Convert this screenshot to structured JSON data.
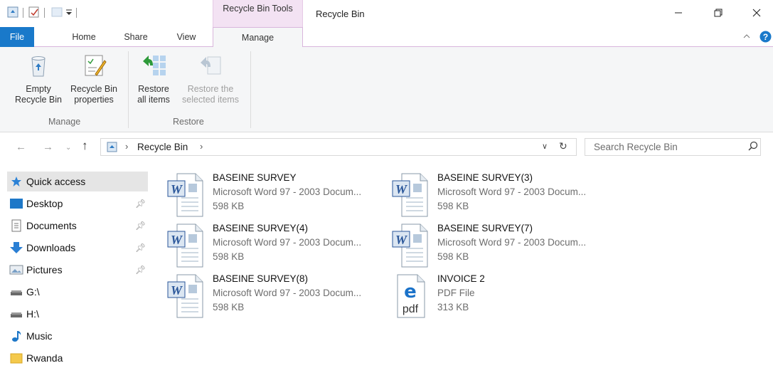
{
  "titlebar": {
    "contextual_tab": "Recycle Bin Tools",
    "window_title": "Recycle Bin",
    "controls": [
      "minimize-icon",
      "restore-icon",
      "close-icon"
    ]
  },
  "ribbon_tabs": [
    {
      "label": "File"
    },
    {
      "label": "Home"
    },
    {
      "label": "Share"
    },
    {
      "label": "View"
    },
    {
      "label": "Manage"
    }
  ],
  "ribbon": {
    "manage_group": {
      "label": "Manage",
      "empty_line1": "Empty",
      "empty_line2": "Recycle Bin",
      "props_line1": "Recycle Bin",
      "props_line2": "properties"
    },
    "restore_group": {
      "label": "Restore",
      "restore_all_line1": "Restore",
      "restore_all_line2": "all items",
      "restore_sel_line1": "Restore the",
      "restore_sel_line2": "selected items"
    }
  },
  "address": {
    "path": "Recycle Bin",
    "search_placeholder": "Search Recycle Bin"
  },
  "nav": {
    "items": [
      {
        "label": "Quick access",
        "icon": "star-icon"
      },
      {
        "label": "Desktop",
        "icon": "desktop-icon",
        "pinned": true
      },
      {
        "label": "Documents",
        "icon": "documents-icon",
        "pinned": true
      },
      {
        "label": "Downloads",
        "icon": "downloads-icon",
        "pinned": true
      },
      {
        "label": "Pictures",
        "icon": "pictures-icon",
        "pinned": true
      },
      {
        "label": "G:\\",
        "icon": "drive-icon"
      },
      {
        "label": "H:\\",
        "icon": "drive-icon"
      },
      {
        "label": "Music",
        "icon": "music-icon"
      },
      {
        "label": "Rwanda",
        "icon": "folder-icon"
      }
    ]
  },
  "files": [
    {
      "name": "BASEINE SURVEY",
      "type": "Microsoft Word 97 - 2003 Docum...",
      "size": "598 KB",
      "icon": "word-doc-icon"
    },
    {
      "name": "BASEINE SURVEY(3)",
      "type": "Microsoft Word 97 - 2003 Docum...",
      "size": "598 KB",
      "icon": "word-doc-icon"
    },
    {
      "name": "BASEINE SURVEY(4)",
      "type": "Microsoft Word 97 - 2003 Docum...",
      "size": "598 KB",
      "icon": "word-doc-icon"
    },
    {
      "name": "BASEINE SURVEY(7)",
      "type": "Microsoft Word 97 - 2003 Docum...",
      "size": "598 KB",
      "icon": "word-doc-icon"
    },
    {
      "name": "BASEINE SURVEY(8)",
      "type": "Microsoft Word 97 - 2003 Docum...",
      "size": "598 KB",
      "icon": "word-doc-icon"
    },
    {
      "name": "INVOICE 2",
      "type": "PDF File",
      "size": "313 KB",
      "icon": "pdf-icon"
    }
  ],
  "colors": {
    "accent": "#1979ca",
    "contextual_tab_bg": "#f3e2f3",
    "selected_nav_bg": "#e5e5e5"
  }
}
